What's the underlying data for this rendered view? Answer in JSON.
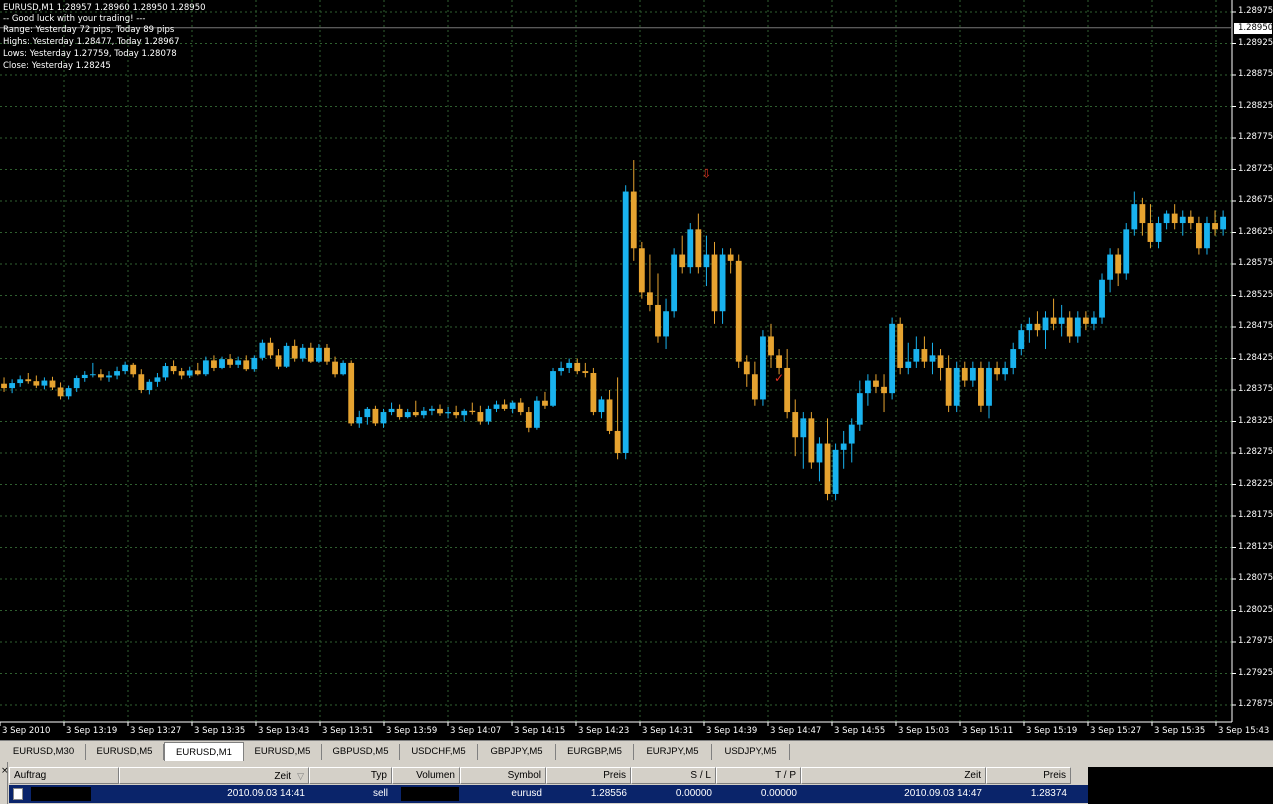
{
  "chart_info": {
    "line1": "EURUSD,M1  1.28957 1.28960 1.28950 1.28950",
    "line2": "-- Good luck with your trading! ---",
    "line3": "Range: Yesterday 72 pips, Today 89 pips",
    "line4": "Highs: Yesterday 1.28477, Today 1.28967",
    "line5": "Lows:  Yesterday 1.27759, Today 1.28078",
    "line6": "Close: Yesterday 1.28245"
  },
  "current_price": "1.28950",
  "colors": {
    "bull": "#19b2ee",
    "bear": "#e6a330",
    "grid": "#2f5f2f",
    "axis": "#ffffff",
    "arrow": "#e03020"
  },
  "chart_data": {
    "type": "candlestick",
    "symbol": "EURUSD",
    "timeframe": "M1",
    "y_ticks": [
      "1.28975",
      "1.28925",
      "1.28875",
      "1.28825",
      "1.28775",
      "1.28725",
      "1.28675",
      "1.28625",
      "1.28575",
      "1.28525",
      "1.28475",
      "1.28425",
      "1.28375",
      "1.28325",
      "1.28275",
      "1.28225",
      "1.28175",
      "1.28125",
      "1.28075",
      "1.28025",
      "1.27975",
      "1.27925",
      "1.27875"
    ],
    "ylim": [
      1.27875,
      1.2899
    ],
    "x_ticks": [
      "3 Sep 2010",
      "3 Sep 13:19",
      "3 Sep 13:27",
      "3 Sep 13:35",
      "3 Sep 13:43",
      "3 Sep 13:51",
      "3 Sep 13:59",
      "3 Sep 14:07",
      "3 Sep 14:15",
      "3 Sep 14:23",
      "3 Sep 14:31",
      "3 Sep 14:39",
      "3 Sep 14:47",
      "3 Sep 14:55",
      "3 Sep 15:03",
      "3 Sep 15:11",
      "3 Sep 15:19",
      "3 Sep 15:27",
      "3 Sep 15:35",
      "3 Sep 15:43"
    ],
    "grid": true,
    "candles": [
      [
        1.28385,
        1.28395,
        1.28372,
        1.28378
      ],
      [
        1.28378,
        1.28392,
        1.2837,
        1.28386
      ],
      [
        1.28386,
        1.28398,
        1.2838,
        1.28392
      ],
      [
        1.28392,
        1.28402,
        1.28385,
        1.28389
      ],
      [
        1.28389,
        1.28398,
        1.28378,
        1.28382
      ],
      [
        1.28382,
        1.28395,
        1.28376,
        1.2839
      ],
      [
        1.2839,
        1.28396,
        1.28375,
        1.28379
      ],
      [
        1.28379,
        1.28387,
        1.2836,
        1.28365
      ],
      [
        1.28365,
        1.28382,
        1.2836,
        1.28378
      ],
      [
        1.28378,
        1.28398,
        1.28372,
        1.28394
      ],
      [
        1.28394,
        1.28405,
        1.28388,
        1.28399
      ],
      [
        1.28399,
        1.28418,
        1.28395,
        1.284
      ],
      [
        1.284,
        1.28408,
        1.2839,
        1.28395
      ],
      [
        1.28395,
        1.28405,
        1.28388,
        1.28398
      ],
      [
        1.28398,
        1.28412,
        1.28392,
        1.28405
      ],
      [
        1.28405,
        1.2842,
        1.284,
        1.28415
      ],
      [
        1.28415,
        1.28418,
        1.28395,
        1.284
      ],
      [
        1.284,
        1.28408,
        1.2837,
        1.28375
      ],
      [
        1.28375,
        1.28392,
        1.28368,
        1.28388
      ],
      [
        1.28388,
        1.28402,
        1.2838,
        1.28395
      ],
      [
        1.28395,
        1.28418,
        1.2839,
        1.28413
      ],
      [
        1.28413,
        1.28422,
        1.284,
        1.28405
      ],
      [
        1.28405,
        1.2841,
        1.28392,
        1.28398
      ],
      [
        1.28398,
        1.28412,
        1.28394,
        1.28406
      ],
      [
        1.28406,
        1.28418,
        1.28398,
        1.284
      ],
      [
        1.284,
        1.28428,
        1.28397,
        1.28422
      ],
      [
        1.28422,
        1.2843,
        1.28405,
        1.2841
      ],
      [
        1.2841,
        1.28428,
        1.28408,
        1.28424
      ],
      [
        1.28424,
        1.28432,
        1.2841,
        1.28415
      ],
      [
        1.28415,
        1.28428,
        1.2841,
        1.28422
      ],
      [
        1.28422,
        1.2843,
        1.28405,
        1.28408
      ],
      [
        1.28408,
        1.2843,
        1.28404,
        1.28426
      ],
      [
        1.28426,
        1.28455,
        1.28422,
        1.2845
      ],
      [
        1.2845,
        1.28458,
        1.28425,
        1.2843
      ],
      [
        1.2843,
        1.2844,
        1.28408,
        1.28412
      ],
      [
        1.28412,
        1.2845,
        1.2841,
        1.28445
      ],
      [
        1.28445,
        1.28455,
        1.2842,
        1.28425
      ],
      [
        1.28425,
        1.28448,
        1.2842,
        1.28442
      ],
      [
        1.28442,
        1.2845,
        1.28418,
        1.2842
      ],
      [
        1.2842,
        1.28448,
        1.28418,
        1.28442
      ],
      [
        1.28442,
        1.28448,
        1.28415,
        1.2842
      ],
      [
        1.2842,
        1.28428,
        1.28395,
        1.284
      ],
      [
        1.284,
        1.28422,
        1.28398,
        1.28418
      ],
      [
        1.28418,
        1.28422,
        1.28318,
        1.28322
      ],
      [
        1.28322,
        1.28342,
        1.28315,
        1.28332
      ],
      [
        1.28332,
        1.28348,
        1.2832,
        1.28345
      ],
      [
        1.28345,
        1.2835,
        1.28318,
        1.28322
      ],
      [
        1.28322,
        1.28345,
        1.28315,
        1.2834
      ],
      [
        1.2834,
        1.28355,
        1.28335,
        1.28345
      ],
      [
        1.28345,
        1.28352,
        1.28328,
        1.28332
      ],
      [
        1.28332,
        1.28345,
        1.2833,
        1.2834
      ],
      [
        1.2834,
        1.28358,
        1.28332,
        1.28335
      ],
      [
        1.28335,
        1.28348,
        1.2833,
        1.28342
      ],
      [
        1.28342,
        1.2835,
        1.28335,
        1.28345
      ],
      [
        1.28345,
        1.28352,
        1.28334,
        1.28338
      ],
      [
        1.28338,
        1.28348,
        1.2833,
        1.2834
      ],
      [
        1.2834,
        1.2835,
        1.2833,
        1.28335
      ],
      [
        1.28335,
        1.28345,
        1.28325,
        1.28342
      ],
      [
        1.28342,
        1.28355,
        1.28336,
        1.2834
      ],
      [
        1.2834,
        1.2835,
        1.2832,
        1.28325
      ],
      [
        1.28325,
        1.2835,
        1.2832,
        1.28345
      ],
      [
        1.28345,
        1.28358,
        1.2834,
        1.28352
      ],
      [
        1.28352,
        1.2836,
        1.28342,
        1.28345
      ],
      [
        1.28345,
        1.28358,
        1.28338,
        1.28355
      ],
      [
        1.28355,
        1.28362,
        1.28335,
        1.2834
      ],
      [
        1.2834,
        1.28348,
        1.28308,
        1.28315
      ],
      [
        1.28315,
        1.28365,
        1.28312,
        1.28358
      ],
      [
        1.28358,
        1.28372,
        1.28345,
        1.2835
      ],
      [
        1.2835,
        1.2841,
        1.28348,
        1.28405
      ],
      [
        1.28405,
        1.2842,
        1.28398,
        1.2841
      ],
      [
        1.2841,
        1.28425,
        1.28402,
        1.28418
      ],
      [
        1.28418,
        1.28425,
        1.284,
        1.28405
      ],
      [
        1.28405,
        1.28418,
        1.28395,
        1.28402
      ],
      [
        1.28402,
        1.2841,
        1.28335,
        1.2834
      ],
      [
        1.2834,
        1.28365,
        1.2833,
        1.2836
      ],
      [
        1.2836,
        1.28375,
        1.28305,
        1.2831
      ],
      [
        1.2831,
        1.28395,
        1.28265,
        1.28275
      ],
      [
        1.28275,
        1.287,
        1.28265,
        1.2869
      ],
      [
        1.2869,
        1.2874,
        1.2858,
        1.286
      ],
      [
        1.286,
        1.2861,
        1.2852,
        1.2853
      ],
      [
        1.2853,
        1.2859,
        1.285,
        1.2851
      ],
      [
        1.2851,
        1.2856,
        1.2845,
        1.2846
      ],
      [
        1.2846,
        1.2852,
        1.2844,
        1.285
      ],
      [
        1.285,
        1.286,
        1.2849,
        1.2859
      ],
      [
        1.2859,
        1.2862,
        1.2856,
        1.2857
      ],
      [
        1.2857,
        1.2864,
        1.2856,
        1.2863
      ],
      [
        1.2863,
        1.28655,
        1.2856,
        1.2857
      ],
      [
        1.2857,
        1.2862,
        1.2854,
        1.2859
      ],
      [
        1.2859,
        1.2861,
        1.2848,
        1.285
      ],
      [
        1.285,
        1.286,
        1.2848,
        1.2859
      ],
      [
        1.2859,
        1.286,
        1.2856,
        1.2858
      ],
      [
        1.2858,
        1.2859,
        1.2841,
        1.2842
      ],
      [
        1.2842,
        1.2843,
        1.2838,
        1.284
      ],
      [
        1.284,
        1.2842,
        1.2835,
        1.2836
      ],
      [
        1.2836,
        1.2847,
        1.2835,
        1.2846
      ],
      [
        1.2846,
        1.2848,
        1.2841,
        1.2843
      ],
      [
        1.2843,
        1.2844,
        1.284,
        1.2841
      ],
      [
        1.2841,
        1.2844,
        1.2833,
        1.2834
      ],
      [
        1.2834,
        1.2836,
        1.2827,
        1.283
      ],
      [
        1.283,
        1.2834,
        1.2825,
        1.2833
      ],
      [
        1.2833,
        1.2834,
        1.2825,
        1.2826
      ],
      [
        1.2826,
        1.283,
        1.2823,
        1.2829
      ],
      [
        1.2829,
        1.2833,
        1.282,
        1.2821
      ],
      [
        1.2821,
        1.2829,
        1.282,
        1.2828
      ],
      [
        1.2828,
        1.2831,
        1.2825,
        1.2829
      ],
      [
        1.2829,
        1.2833,
        1.2826,
        1.2832
      ],
      [
        1.2832,
        1.2839,
        1.2831,
        1.2837
      ],
      [
        1.2837,
        1.284,
        1.2835,
        1.2839
      ],
      [
        1.2839,
        1.284,
        1.2837,
        1.2838
      ],
      [
        1.2838,
        1.284,
        1.2834,
        1.2837
      ],
      [
        1.2837,
        1.2849,
        1.2836,
        1.2848
      ],
      [
        1.2848,
        1.2849,
        1.284,
        1.2841
      ],
      [
        1.2841,
        1.2845,
        1.284,
        1.2842
      ],
      [
        1.2842,
        1.2846,
        1.2841,
        1.2844
      ],
      [
        1.2844,
        1.2846,
        1.2841,
        1.2842
      ],
      [
        1.2842,
        1.2845,
        1.284,
        1.2843
      ],
      [
        1.2843,
        1.2844,
        1.2839,
        1.2841
      ],
      [
        1.2841,
        1.2843,
        1.2834,
        1.2835
      ],
      [
        1.2835,
        1.2842,
        1.2834,
        1.2841
      ],
      [
        1.2841,
        1.2842,
        1.2838,
        1.2839
      ],
      [
        1.2839,
        1.2842,
        1.2838,
        1.2841
      ],
      [
        1.2841,
        1.2842,
        1.2834,
        1.2835
      ],
      [
        1.2835,
        1.2842,
        1.2833,
        1.2841
      ],
      [
        1.2841,
        1.2842,
        1.2839,
        1.284
      ],
      [
        1.284,
        1.2842,
        1.2839,
        1.2841
      ],
      [
        1.2841,
        1.2845,
        1.284,
        1.2844
      ],
      [
        1.2844,
        1.2848,
        1.2843,
        1.2847
      ],
      [
        1.2847,
        1.2849,
        1.2845,
        1.2848
      ],
      [
        1.2848,
        1.285,
        1.2846,
        1.2847
      ],
      [
        1.2847,
        1.285,
        1.2844,
        1.2849
      ],
      [
        1.2849,
        1.2852,
        1.2847,
        1.2848
      ],
      [
        1.2848,
        1.2851,
        1.2846,
        1.2849
      ],
      [
        1.2849,
        1.285,
        1.2845,
        1.2846
      ],
      [
        1.2846,
        1.285,
        1.2845,
        1.2849
      ],
      [
        1.2849,
        1.285,
        1.2847,
        1.2848
      ],
      [
        1.2848,
        1.285,
        1.2847,
        1.2849
      ],
      [
        1.2849,
        1.2856,
        1.2848,
        1.2855
      ],
      [
        1.2855,
        1.286,
        1.2853,
        1.2859
      ],
      [
        1.2859,
        1.286,
        1.2854,
        1.2856
      ],
      [
        1.2856,
        1.2864,
        1.2855,
        1.2863
      ],
      [
        1.2863,
        1.2869,
        1.2862,
        1.2867
      ],
      [
        1.2867,
        1.2868,
        1.2862,
        1.2864
      ],
      [
        1.2864,
        1.2867,
        1.286,
        1.2861
      ],
      [
        1.2861,
        1.2865,
        1.286,
        1.2864
      ],
      [
        1.2864,
        1.2866,
        1.2863,
        1.28655
      ],
      [
        1.28655,
        1.2867,
        1.2863,
        1.2864
      ],
      [
        1.2864,
        1.2866,
        1.2862,
        1.2865
      ],
      [
        1.2865,
        1.2866,
        1.2863,
        1.2864
      ],
      [
        1.2864,
        1.2865,
        1.2859,
        1.286
      ],
      [
        1.286,
        1.2865,
        1.2859,
        1.2864
      ],
      [
        1.2864,
        1.2866,
        1.2862,
        1.2863
      ],
      [
        1.2863,
        1.2866,
        1.2862,
        1.2865
      ]
    ]
  },
  "signals": [
    {
      "name": "sell-signal-arrow-icon",
      "glyph": "⇩",
      "candle": 87,
      "price": 1.28712
    },
    {
      "name": "exit-checkmark-icon",
      "glyph": "✓",
      "candle": 96,
      "price": 1.28388
    }
  ],
  "tabs": [
    "EURUSD,M30",
    "EURUSD,M5",
    "EURUSD,M1",
    "EURUSD,M5",
    "GBPUSD,M5",
    "USDCHF,M5",
    "GBPJPY,M5",
    "EURGBP,M5",
    "EURJPY,M5",
    "USDJPY,M5"
  ],
  "active_tab": 2,
  "terminal": {
    "close_label": "×",
    "columns": [
      "Auftrag",
      "Zeit",
      "Typ",
      "Volumen",
      "Symbol",
      "Preis",
      "S / L",
      "T / P",
      "Zeit",
      "Preis"
    ],
    "sort_indicator": "▽",
    "row": {
      "time_open": "2010.09.03 14:41",
      "type": "sell",
      "symbol": "eurusd",
      "price_open": "1.28556",
      "sl": "0.00000",
      "tp": "0.00000",
      "time_close": "2010.09.03 14:47",
      "price_close": "1.28374"
    }
  }
}
